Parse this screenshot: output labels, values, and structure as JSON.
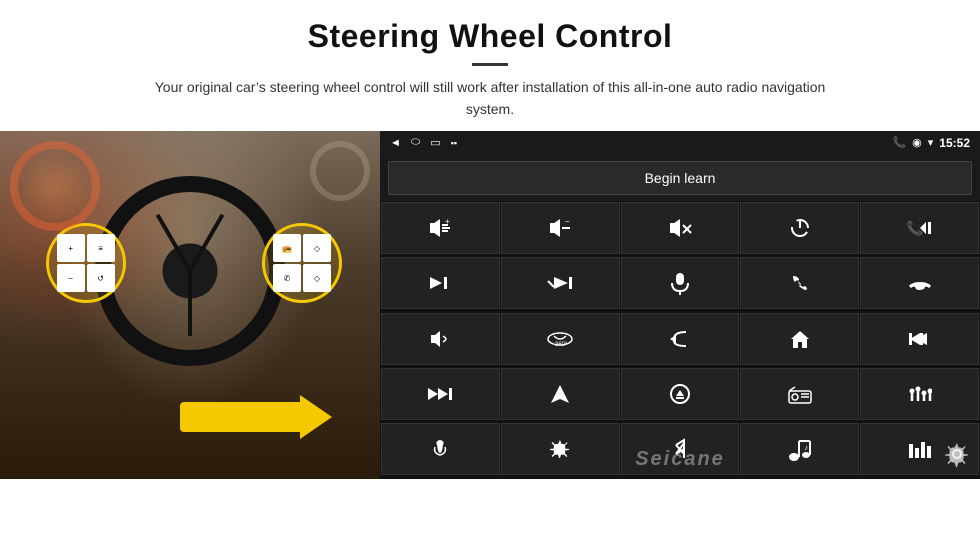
{
  "page": {
    "title": "Steering Wheel Control",
    "divider": true,
    "subtitle": "Your original car’s steering wheel control will still work after installation of this all-in-one auto radio navigation system."
  },
  "status_bar": {
    "left_icons": [
      "◄",
      "□",
      "□"
    ],
    "right_icons": [
      "📶",
      "▶︎",
      "▾"
    ],
    "time": "15:52",
    "phone_icon": "📞",
    "location_icon": "▶",
    "signal_icon": "▾"
  },
  "begin_learn": {
    "label": "Begin learn"
  },
  "grid": {
    "icons": [
      {
        "symbol": "🔊+",
        "name": "vol-up"
      },
      {
        "symbol": "🔊-",
        "name": "vol-down"
      },
      {
        "symbol": "🔇",
        "name": "mute"
      },
      {
        "symbol": "⏻",
        "name": "power"
      },
      {
        "symbol": "📞⏮",
        "name": "phone-prev"
      },
      {
        "symbol": "⏭",
        "name": "next-track"
      },
      {
        "symbol": "⏸⏭",
        "name": "pause-next"
      },
      {
        "symbol": "🎤",
        "name": "mic"
      },
      {
        "symbol": "📞",
        "name": "phone"
      },
      {
        "symbol": "↩",
        "name": "hang-up"
      },
      {
        "symbol": "📢",
        "name": "speaker"
      },
      {
        "symbol": "360°",
        "name": "360-view"
      },
      {
        "symbol": "↺",
        "name": "back"
      },
      {
        "symbol": "🏠",
        "name": "home"
      },
      {
        "symbol": "⏮⏮",
        "name": "prev-prev"
      },
      {
        "symbol": "⏩",
        "name": "fast-fwd"
      },
      {
        "symbol": "➤",
        "name": "nav"
      },
      {
        "symbol": "⏏",
        "name": "eject"
      },
      {
        "symbol": "📻",
        "name": "radio"
      },
      {
        "symbol": "⚙",
        "name": "settings-eq"
      },
      {
        "symbol": "🎤",
        "name": "voice"
      },
      {
        "symbol": "⚙",
        "name": "settings2"
      },
      {
        "symbol": "✱",
        "name": "bluetooth"
      },
      {
        "symbol": "🎵",
        "name": "music"
      },
      {
        "symbol": "📊",
        "name": "equalizer"
      }
    ]
  },
  "watermark": {
    "text": "Seicane"
  },
  "gear_icon": {
    "symbol": "⚙",
    "label": "settings"
  }
}
